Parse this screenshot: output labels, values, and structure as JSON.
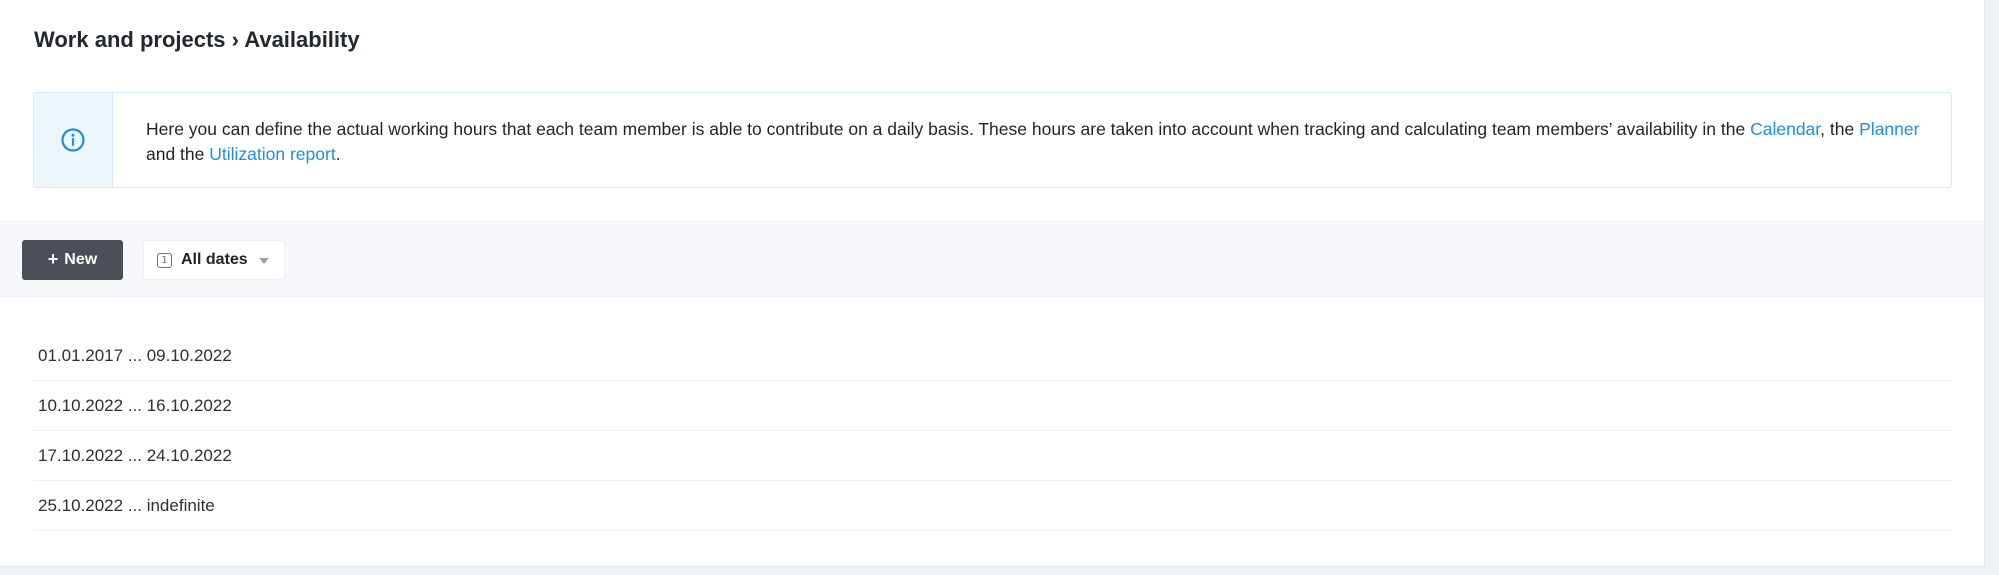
{
  "header": {
    "breadcrumb": "Work and projects › Availability"
  },
  "info": {
    "icon": "info-icon",
    "text_main": "Here you can define the actual working hours that each team member is able to contribute on a daily basis. These hours are taken into account when tracking and calculating team members’ availability in the ",
    "link_calendar": "Calendar",
    "sep_1": ", the ",
    "link_planner": "Planner",
    "sep_2": " and the ",
    "link_utilization": "Utilization report",
    "end": "."
  },
  "toolbar": {
    "new_plus": "+",
    "new_label": "New",
    "date_icon_digit": "1",
    "date_filter_label": "All dates"
  },
  "periods": [
    "01.01.2017 ... 09.10.2022",
    "10.10.2022 ... 16.10.2022",
    "17.10.2022 ... 24.10.2022",
    "25.10.2022 ... indefinite"
  ],
  "colors": {
    "accent_link": "#1f8fd6",
    "button_dark": "#4a4f57",
    "info_bg": "#edf6fc"
  }
}
